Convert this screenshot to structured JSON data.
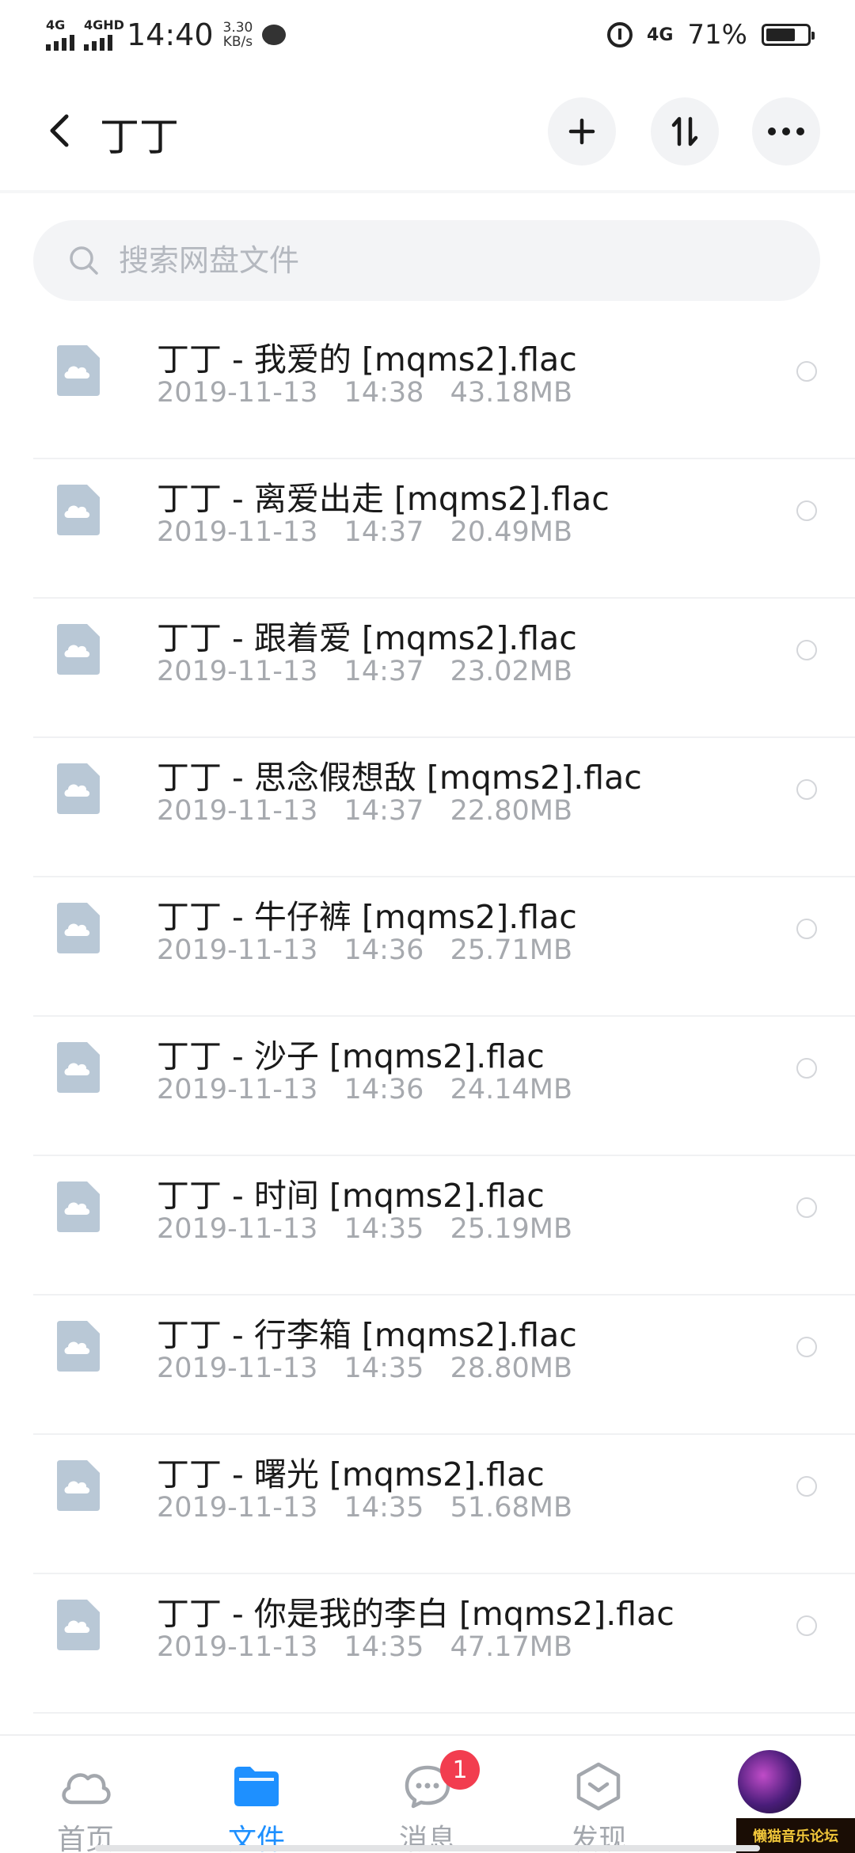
{
  "status_bar": {
    "signal1_label": "4G",
    "signal2_label": "4GHD",
    "time": "14:40",
    "speed_value": "3.30",
    "speed_unit": "KB/s",
    "net_label": "4G",
    "battery_percent": "71%",
    "battery_level": 0.71
  },
  "header": {
    "title": "丁丁"
  },
  "search": {
    "placeholder": "搜索网盘文件"
  },
  "files": [
    {
      "name": "丁丁 - 我爱的 [mqms2].flac",
      "date": "2019-11-13",
      "time": "14:38",
      "size": "43.18MB"
    },
    {
      "name": "丁丁 - 离爱出走 [mqms2].flac",
      "date": "2019-11-13",
      "time": "14:37",
      "size": "20.49MB"
    },
    {
      "name": "丁丁 - 跟着爱 [mqms2].flac",
      "date": "2019-11-13",
      "time": "14:37",
      "size": "23.02MB"
    },
    {
      "name": "丁丁 - 思念假想敌 [mqms2].flac",
      "date": "2019-11-13",
      "time": "14:37",
      "size": "22.80MB"
    },
    {
      "name": "丁丁 - 牛仔裤 [mqms2].flac",
      "date": "2019-11-13",
      "time": "14:36",
      "size": "25.71MB"
    },
    {
      "name": "丁丁 - 沙子 [mqms2].flac",
      "date": "2019-11-13",
      "time": "14:36",
      "size": "24.14MB"
    },
    {
      "name": "丁丁 - 时间 [mqms2].flac",
      "date": "2019-11-13",
      "time": "14:35",
      "size": "25.19MB"
    },
    {
      "name": "丁丁 - 行李箱 [mqms2].flac",
      "date": "2019-11-13",
      "time": "14:35",
      "size": "28.80MB"
    },
    {
      "name": "丁丁 - 曙光 [mqms2].flac",
      "date": "2019-11-13",
      "time": "14:35",
      "size": "51.68MB"
    },
    {
      "name": "丁丁 - 你是我的李白 [mqms2].flac",
      "date": "2019-11-13",
      "time": "14:35",
      "size": "47.17MB"
    }
  ],
  "tabbar": {
    "home": "首页",
    "files": "文件",
    "messages": "消息",
    "messages_badge": "1",
    "discover": "发现"
  },
  "watermark": "懒猫音乐论坛",
  "colors": {
    "accent": "#1e90ff",
    "badge": "#f23d4f",
    "file_icon": "#b9c8d6"
  }
}
